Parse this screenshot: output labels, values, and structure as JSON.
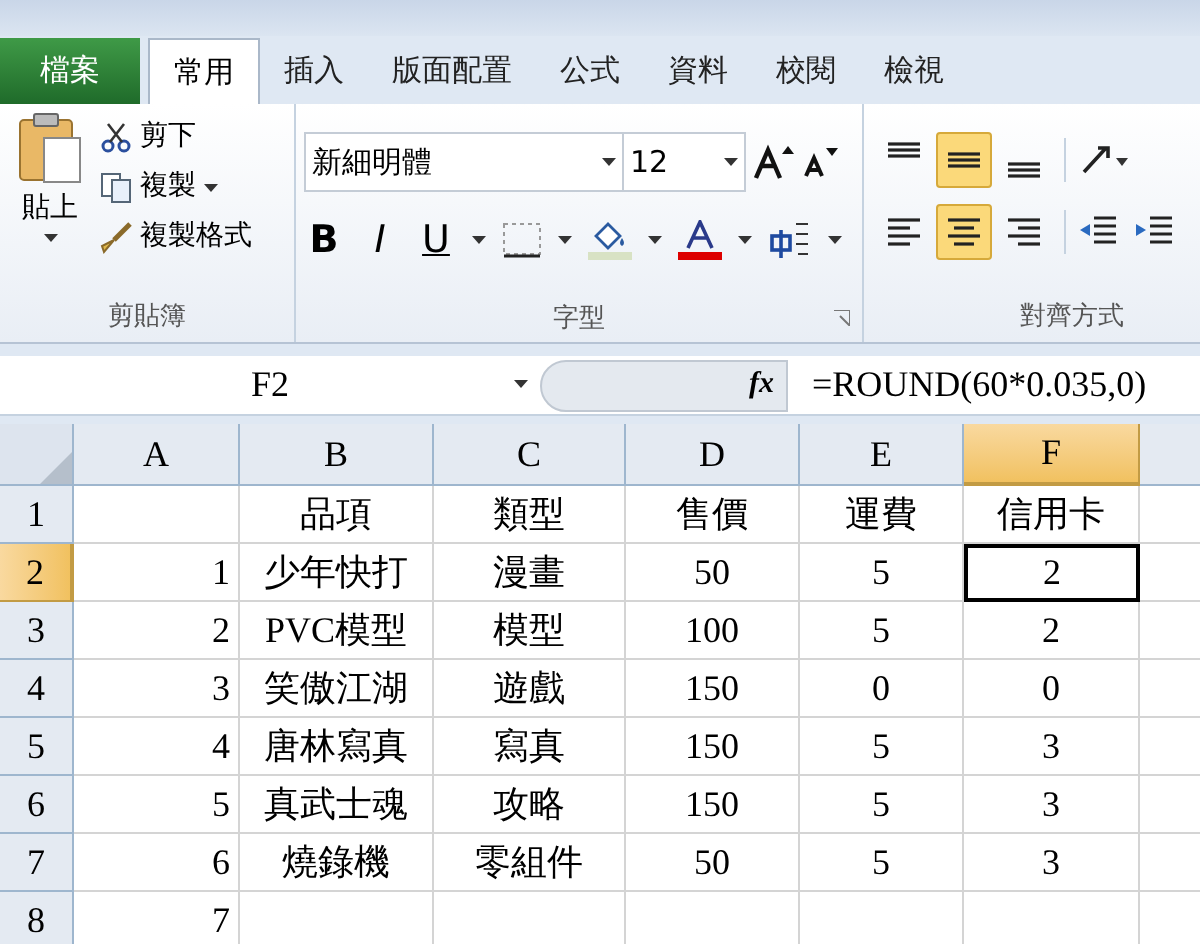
{
  "tabs": [
    {
      "label": "檔案",
      "kind": "file",
      "selected": false
    },
    {
      "label": "常用",
      "kind": "tab",
      "selected": true
    },
    {
      "label": "插入",
      "kind": "tab",
      "selected": false
    },
    {
      "label": "版面配置",
      "kind": "tab",
      "selected": false
    },
    {
      "label": "公式",
      "kind": "tab",
      "selected": false
    },
    {
      "label": "資料",
      "kind": "tab",
      "selected": false
    },
    {
      "label": "校閱",
      "kind": "tab",
      "selected": false
    },
    {
      "label": "檢視",
      "kind": "tab",
      "selected": false
    }
  ],
  "clipboard": {
    "paste": "貼上",
    "cut": "剪下",
    "copy": "複製",
    "format_painter": "複製格式",
    "group_label": "剪貼簿"
  },
  "font": {
    "font_name": "新細明體",
    "font_size": "12",
    "bold": "B",
    "italic": "I",
    "underline": "U",
    "group_label": "字型"
  },
  "alignment": {
    "top_row": [
      {
        "kind": "top",
        "selected": false
      },
      {
        "kind": "middle",
        "selected": true
      },
      {
        "kind": "bottom",
        "selected": false
      }
    ],
    "bottom_row": [
      {
        "kind": "left",
        "selected": false
      },
      {
        "kind": "center",
        "selected": true
      },
      {
        "kind": "right",
        "selected": false
      }
    ],
    "group_label": "對齊方式"
  },
  "formula_bar": {
    "name_box": "F2",
    "function_label": "fx",
    "formula": "=ROUND(60*0.035,0)"
  },
  "columns": [
    {
      "label": "A",
      "selected": false
    },
    {
      "label": "B",
      "selected": false
    },
    {
      "label": "C",
      "selected": false
    },
    {
      "label": "D",
      "selected": false
    },
    {
      "label": "E",
      "selected": false
    },
    {
      "label": "F",
      "selected": true
    }
  ],
  "rows": [
    {
      "number": "1",
      "selected": false,
      "cells": [
        {
          "text": "",
          "selected": false
        },
        {
          "text": "品項",
          "selected": false
        },
        {
          "text": "類型",
          "selected": false
        },
        {
          "text": "售價",
          "selected": false
        },
        {
          "text": "運費",
          "selected": false
        },
        {
          "text": "信用卡",
          "selected": false
        }
      ]
    },
    {
      "number": "2",
      "selected": true,
      "cells": [
        {
          "text": "1",
          "selected": false
        },
        {
          "text": "少年快打",
          "selected": false
        },
        {
          "text": "漫畫",
          "selected": false
        },
        {
          "text": "50",
          "selected": false
        },
        {
          "text": "5",
          "selected": false
        },
        {
          "text": "2",
          "selected": true
        }
      ]
    },
    {
      "number": "3",
      "selected": false,
      "cells": [
        {
          "text": "2",
          "selected": false
        },
        {
          "text": "PVC模型",
          "selected": false
        },
        {
          "text": "模型",
          "selected": false
        },
        {
          "text": "100",
          "selected": false
        },
        {
          "text": "5",
          "selected": false
        },
        {
          "text": "2",
          "selected": false
        }
      ]
    },
    {
      "number": "4",
      "selected": false,
      "cells": [
        {
          "text": "3",
          "selected": false
        },
        {
          "text": "笑傲江湖",
          "selected": false
        },
        {
          "text": "遊戲",
          "selected": false
        },
        {
          "text": "150",
          "selected": false
        },
        {
          "text": "0",
          "selected": false
        },
        {
          "text": "0",
          "selected": false
        }
      ]
    },
    {
      "number": "5",
      "selected": false,
      "cells": [
        {
          "text": "4",
          "selected": false
        },
        {
          "text": "唐林寫真",
          "selected": false
        },
        {
          "text": "寫真",
          "selected": false
        },
        {
          "text": "150",
          "selected": false
        },
        {
          "text": "5",
          "selected": false
        },
        {
          "text": "3",
          "selected": false
        }
      ]
    },
    {
      "number": "6",
      "selected": false,
      "cells": [
        {
          "text": "5",
          "selected": false
        },
        {
          "text": "真武士魂",
          "selected": false
        },
        {
          "text": "攻略",
          "selected": false
        },
        {
          "text": "150",
          "selected": false
        },
        {
          "text": "5",
          "selected": false
        },
        {
          "text": "3",
          "selected": false
        }
      ]
    },
    {
      "number": "7",
      "selected": false,
      "cells": [
        {
          "text": "6",
          "selected": false
        },
        {
          "text": "燒錄機",
          "selected": false
        },
        {
          "text": "零組件",
          "selected": false
        },
        {
          "text": "50",
          "selected": false
        },
        {
          "text": "5",
          "selected": false
        },
        {
          "text": "3",
          "selected": false
        }
      ]
    },
    {
      "number": "8",
      "selected": false,
      "cells": [
        {
          "text": "7",
          "selected": false
        },
        {
          "text": "",
          "selected": false
        },
        {
          "text": "",
          "selected": false
        },
        {
          "text": "",
          "selected": false
        },
        {
          "text": "",
          "selected": false
        },
        {
          "text": "",
          "selected": false
        }
      ]
    }
  ]
}
